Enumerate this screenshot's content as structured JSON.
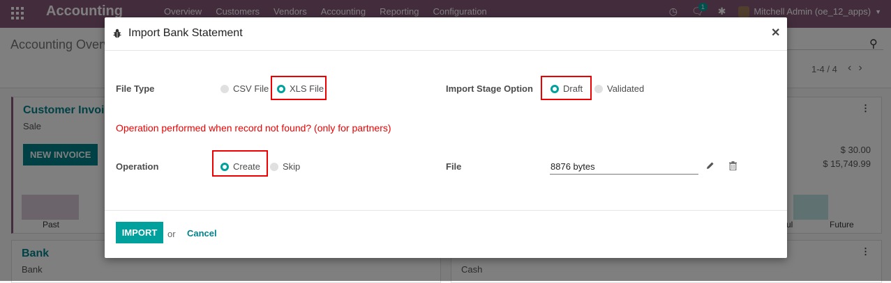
{
  "navbar": {
    "brand": "Accounting",
    "menu": [
      "Overview",
      "Customers",
      "Vendors",
      "Accounting",
      "Reporting",
      "Configuration"
    ],
    "chat_count": "1",
    "user": "Mitchell Admin (oe_12_apps)"
  },
  "control_panel": {
    "breadcrumb": "Accounting Overv",
    "pager": "1-4 / 4"
  },
  "dashboard": {
    "sales_card": {
      "title": "Customer Invoic",
      "subtitle": "Sale",
      "new_invoice_label": "NEW INVOICE",
      "axis_past": "Past",
      "axis_due": "ul",
      "axis_future": "Future",
      "amount_1": "$ 30.00",
      "amount_2": "$ 15,749.99"
    },
    "bank_card": {
      "title": "Bank",
      "subtitle": "Bank"
    },
    "cash_card": {
      "subtitle": "Cash"
    }
  },
  "modal": {
    "title": "Import Bank Statement",
    "file_type_label": "File Type",
    "file_type_options": [
      {
        "label": "CSV File",
        "selected": false
      },
      {
        "label": "XLS File",
        "selected": true
      }
    ],
    "stage_label": "Import Stage Option",
    "stage_options": [
      {
        "label": "Draft",
        "selected": true
      },
      {
        "label": "Validated",
        "selected": false
      }
    ],
    "warning": "Operation performed when record not found? (only for partners)",
    "operation_label": "Operation",
    "operation_options": [
      {
        "label": "Create",
        "selected": true
      },
      {
        "label": "Skip",
        "selected": false
      }
    ],
    "file_label": "File",
    "file_value": "8876 bytes",
    "import_label": "IMPORT",
    "or_text": "or",
    "cancel_label": "Cancel"
  },
  "colors": {
    "brand": "#875a7b",
    "accent": "#00a09d",
    "highlight": "#ee0000"
  }
}
